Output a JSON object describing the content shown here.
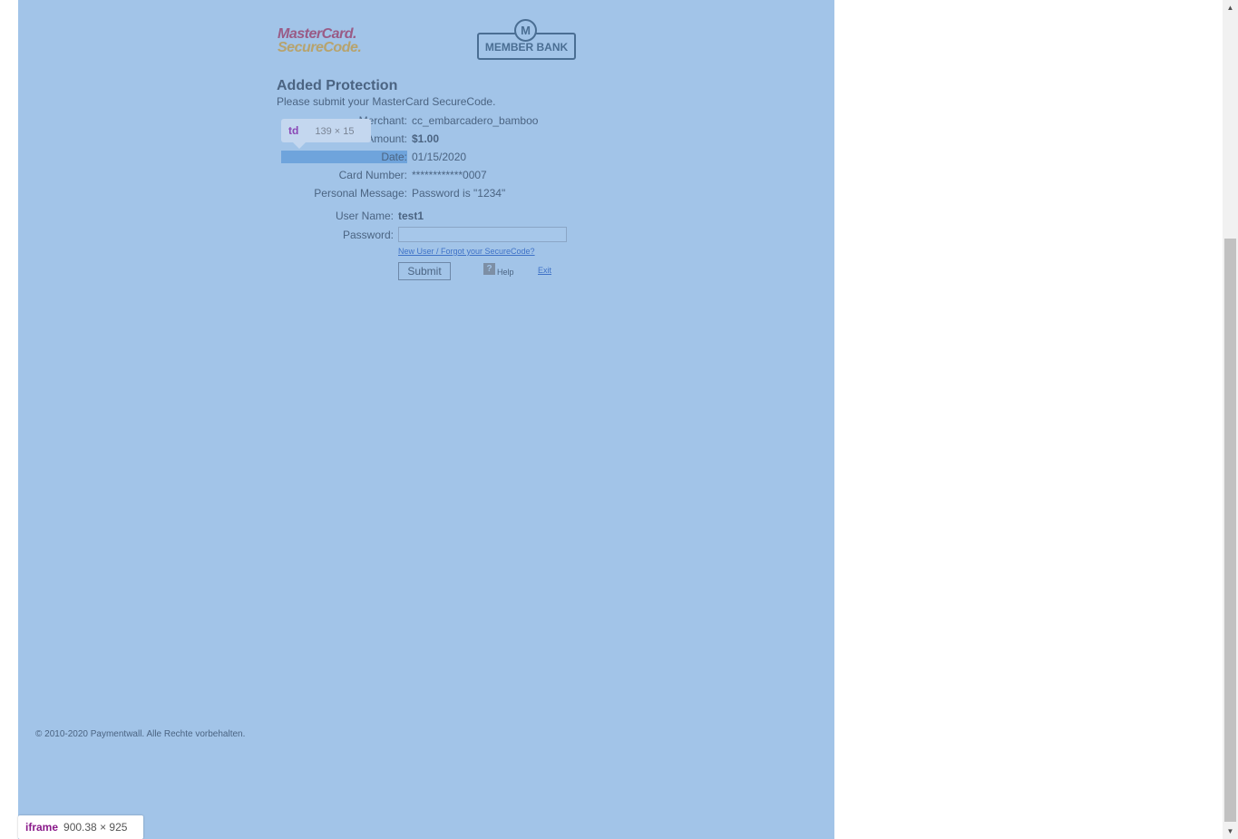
{
  "logos": {
    "mastercard_line1": "MasterCard.",
    "mastercard_line2": "SecureCode.",
    "member_bank": "MEMBER BANK",
    "member_bank_mark": "M"
  },
  "form": {
    "title": "Added Protection",
    "subtitle": "Please submit your MasterCard SecureCode.",
    "fields": [
      {
        "label": "Merchant:",
        "value": "cc_embarcadero_bamboo"
      },
      {
        "label": "Amount:",
        "value": "$1.00"
      },
      {
        "label": "Date:",
        "value": "01/15/2020"
      },
      {
        "label": "Card Number:",
        "value": "************0007"
      },
      {
        "label": "Personal Message:",
        "value": "Password is \"1234\""
      }
    ],
    "username_label": "User Name:",
    "username_value": "test1",
    "password_label": "Password:",
    "password_value": "",
    "forgot_link": "New User / Forgot your SecureCode?",
    "submit_label": "Submit",
    "help_icon_glyph": "?",
    "help_label": "Help",
    "exit_label": "Exit"
  },
  "devtools": {
    "tooltip_tag": "td",
    "tooltip_dims": "139 × 15",
    "iframe_tag": "iframe",
    "iframe_dims": "900.38 × 925"
  },
  "footer": {
    "copyright": "© 2010-2020 Paymentwall. Alle Rechte vorbehalten."
  },
  "scrollbar": {
    "up_glyph": "▲",
    "down_glyph": "▼"
  },
  "colors": {
    "overlay": "#a2c4e8",
    "highlight": "#6fa4dc",
    "text": "#4b6482"
  }
}
